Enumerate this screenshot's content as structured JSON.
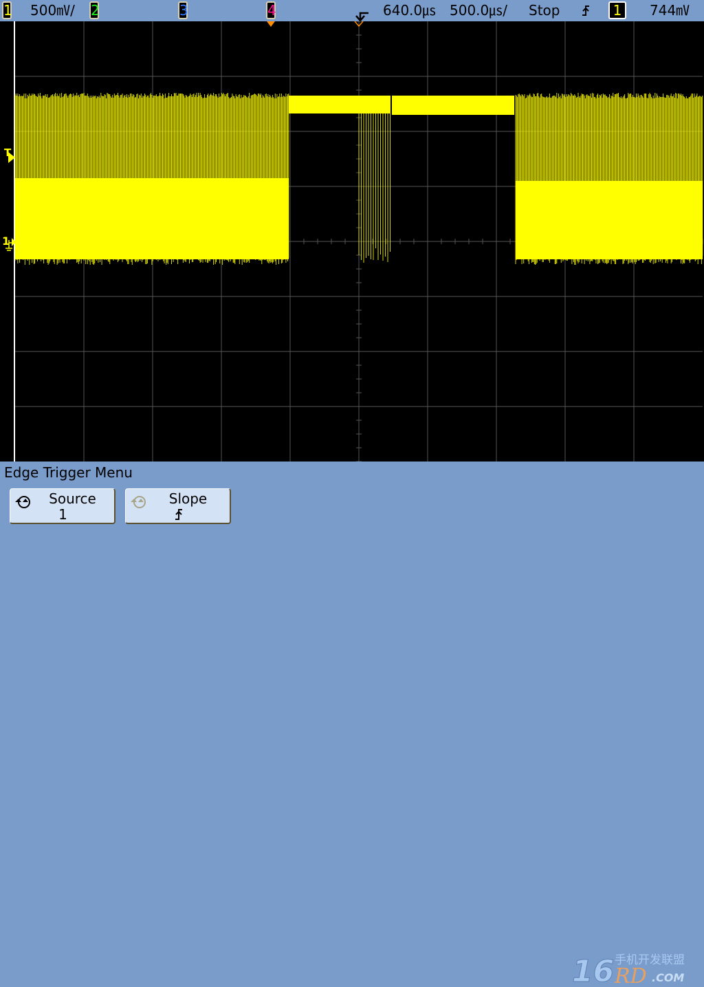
{
  "status_bar": {
    "ch1": {
      "label": "1",
      "color": "#ffff00",
      "scale": "500㎷/"
    },
    "ch2": {
      "label": "2",
      "color": "#22ee22"
    },
    "ch3": {
      "label": "3",
      "color": "#3377ff"
    },
    "ch4": {
      "label": "4",
      "color": "#ff1493"
    },
    "time_delay": "640.0㎲",
    "time_scale": "500.0㎲/",
    "run_state": "Stop",
    "trigger_slope_icon": "rising-edge-icon",
    "trigger_source": "1",
    "trigger_level": "744㎷"
  },
  "screen": {
    "trigger_marker": "T",
    "ch1_ground_marker": "1",
    "trace_color": "#ffff00",
    "grid_divisions": {
      "horizontal": 10,
      "vertical": 8
    }
  },
  "menu": {
    "title": "Edge Trigger Menu",
    "softkeys": [
      {
        "label": "Source",
        "value": "1",
        "icon": "rotate-knob-icon"
      },
      {
        "label": "Slope",
        "icon": "rotate-knob-icon-disabled",
        "value_icon": "rising-edge-icon"
      }
    ]
  },
  "watermark": {
    "text": "16RD.COM 手机开发联盟"
  }
}
